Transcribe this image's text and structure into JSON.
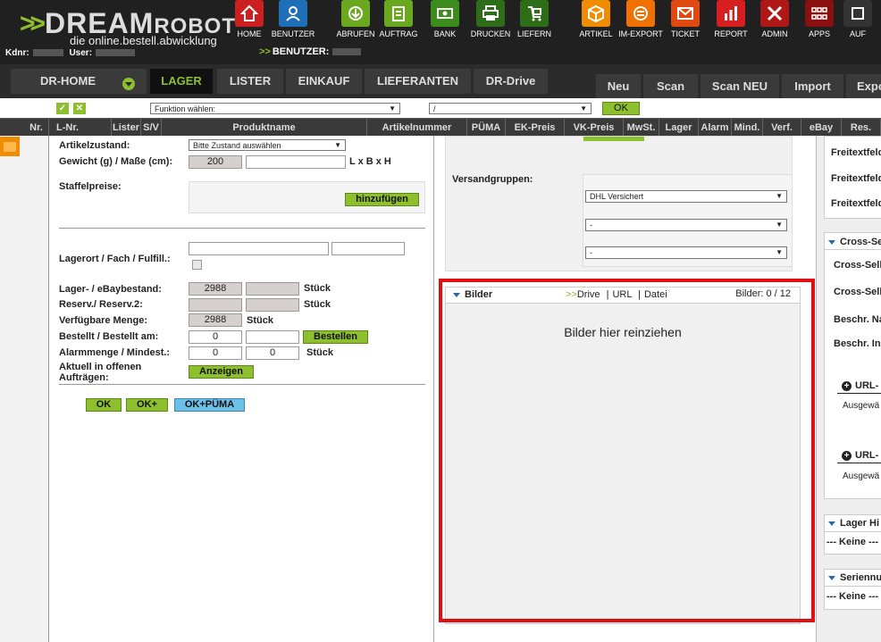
{
  "brand": {
    "name_big": "DREAM",
    "name_small": "ROBOT",
    "tagline": "die online.bestell.abwicklung",
    "kdnr_label": "Kdnr:",
    "user_label": "User:",
    "benutzer_label": "BENUTZER:"
  },
  "toolbar": [
    {
      "label": "HOME",
      "icon": "home-icon",
      "color": "#cc1f1f"
    },
    {
      "label": "BENUTZER",
      "icon": "users-icon",
      "color": "#1f6fb8"
    },
    {
      "label": "ABRUFEN",
      "icon": "download-icon",
      "color": "#6aa820"
    },
    {
      "label": "AUFTRAG",
      "icon": "order-icon",
      "color": "#6aa820"
    },
    {
      "label": "BANK",
      "icon": "bank-icon",
      "color": "#3c8c1c"
    },
    {
      "label": "DRUCKEN",
      "icon": "printer-icon",
      "color": "#2f6e18"
    },
    {
      "label": "LIEFERN",
      "icon": "cart-icon",
      "color": "#2f6e18"
    },
    {
      "label": "ARTIKEL",
      "icon": "box-icon",
      "color": "#f08c00"
    },
    {
      "label": "IM-EXPORT",
      "icon": "exchange-icon",
      "color": "#f07000"
    },
    {
      "label": "TICKET",
      "icon": "mail-icon",
      "color": "#e04a10"
    },
    {
      "label": "REPORT",
      "icon": "chart-icon",
      "color": "#d81f1f"
    },
    {
      "label": "ADMIN",
      "icon": "tools-icon",
      "color": "#b01818"
    },
    {
      "label": "APPS",
      "icon": "grid-icon",
      "color": "#8a1010"
    },
    {
      "label": "AUF",
      "icon": "more-icon",
      "color": "#333333"
    }
  ],
  "main_tabs": [
    "DR-HOME",
    "LAGER",
    "LISTER",
    "EINKAUF",
    "LIEFERANTEN",
    "DR-Drive"
  ],
  "sub_tabs": [
    "Neu",
    "Scan",
    "Scan NEU",
    "Import",
    "Expo"
  ],
  "filter": {
    "function_select": "Funktion wählen:",
    "second_select": "/",
    "ok": "OK"
  },
  "columns": [
    "Nr.",
    "L-Nr.",
    "Lister",
    "S/V",
    "Produktname",
    "Artikelnummer",
    "PÜMA",
    "EK-Preis",
    "VK-Preis",
    "MwSt.",
    "Lager",
    "Alarm",
    "Mind.",
    "Verf.",
    "eBay",
    "Res."
  ],
  "left": {
    "artikelzustand_label": "Artikelzustand:",
    "artikelzustand_value": "Bitte Zustand auswählen",
    "gewicht_label": "Gewicht (g) / Maße (cm):",
    "gewicht_value": "200",
    "masse_unit": "L x B x H",
    "staffel_label": "Staffelpreise:",
    "hinzufuegen": "hinzufügen",
    "lagerort_label": "Lagerort / Fach / Fulfill.:",
    "lagerbestand_label": "Lager- / eBaybestand:",
    "lagerbestand_value": "2988",
    "stueck": "Stück",
    "reserv_label": "Reserv./ Reserv.2:",
    "verfuegbar_label": "Verfügbare Menge:",
    "verfuegbar_value": "2988",
    "bestellt_label": "Bestellt / Bestellt am:",
    "bestellt_value": "0",
    "bestellen": "Bestellen",
    "alarm_label": "Alarmmenge / Mindest.:",
    "alarm_value": "0",
    "mindest_value": "0",
    "aktuell_label_1": "Aktuell in offenen",
    "aktuell_label_2": "Aufträgen:",
    "anzeigen": "Anzeigen",
    "ok": "OK",
    "ok_plus": "OK+",
    "ok_puema": "OK+PÜMA"
  },
  "middle": {
    "versand_label": "Versandgruppen:",
    "versand_1": "DHL Versichert",
    "versand_2": "-",
    "versand_3": "-",
    "bilder_title": "Bilder",
    "bilder_arrows": ">>",
    "bilder_drive": "Drive",
    "bilder_sep": "|",
    "bilder_url": "URL",
    "bilder_datei": "Datei",
    "bilder_count": "Bilder: 0 / 12",
    "bilder_drop": "Bilder hier reinziehen"
  },
  "right": {
    "freitext": "Freitextfeld",
    "cross_title": "Cross-Se",
    "cross_sell": "Cross-Sell",
    "beschr_na": "Beschr. Na",
    "beschr_in": "Beschr. In",
    "url_label": "URL-",
    "ausgew": "Ausgewä",
    "lager_title": "Lager Hi",
    "keine": "--- Keine ---",
    "serien_title": "Seriennu"
  }
}
